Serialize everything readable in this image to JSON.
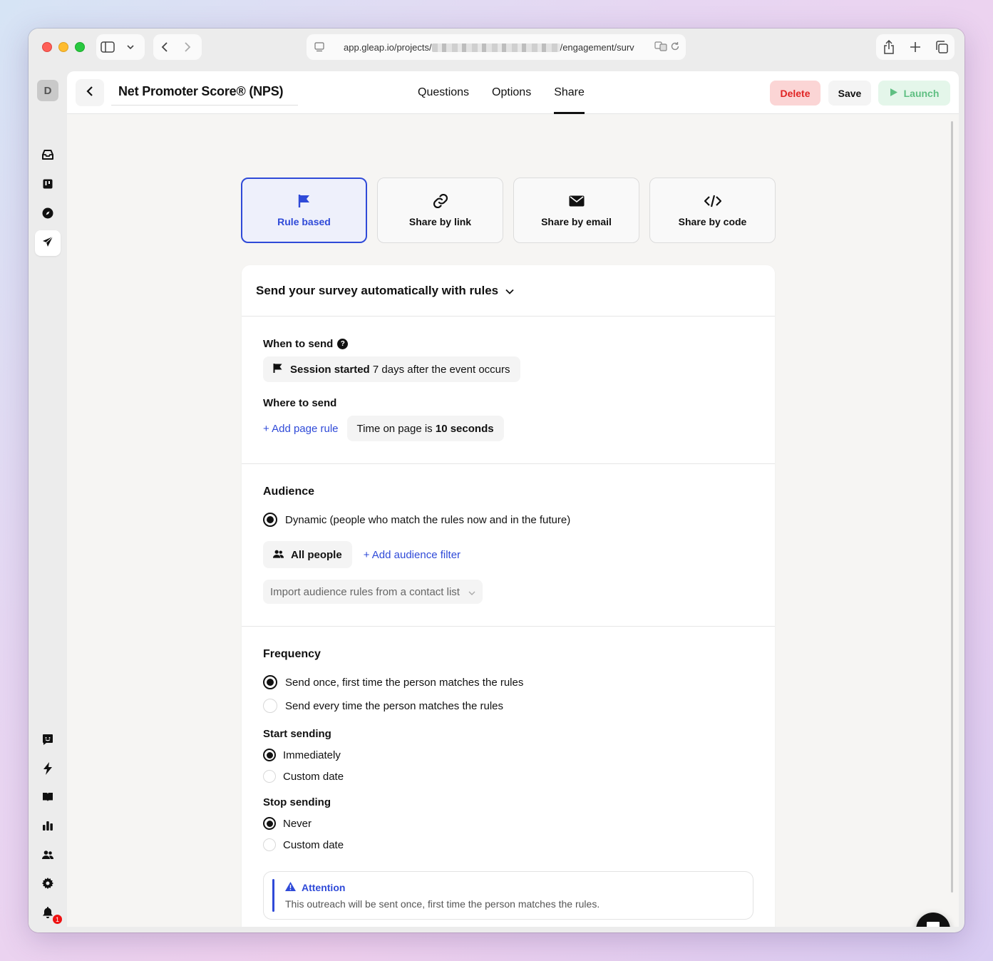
{
  "browser": {
    "url_prefix": "app.gleap.io/projects/",
    "url_suffix": "/engagement/surv"
  },
  "header": {
    "survey_title": "Net Promoter Score® (NPS)",
    "tabs": [
      {
        "label": "Questions"
      },
      {
        "label": "Options"
      },
      {
        "label": "Share"
      }
    ],
    "delete_label": "Delete",
    "save_label": "Save",
    "launch_label": "Launch"
  },
  "sidebar": {
    "workspace_initial": "D",
    "notification_count": "1"
  },
  "share_options": [
    {
      "label": "Rule based",
      "icon": "flag-icon"
    },
    {
      "label": "Share by link",
      "icon": "link-icon"
    },
    {
      "label": "Share by email",
      "icon": "envelope-icon"
    },
    {
      "label": "Share by code",
      "icon": "code-icon"
    }
  ],
  "panel": {
    "heading": "Send your survey automatically with rules",
    "when": {
      "label": "When to send",
      "event_name": "Session started",
      "event_detail": "7 days after the event occurs"
    },
    "where": {
      "label": "Where to send",
      "add_rule": "+ Add page rule",
      "rule_prefix": "Time on page is",
      "rule_value": "10 seconds"
    },
    "audience": {
      "label": "Audience",
      "option_dynamic": "Dynamic (people who match the rules now and in the future)",
      "all_people": "All people",
      "add_filter": "+ Add audience filter",
      "import_placeholder": "Import audience rules from a contact list"
    },
    "frequency": {
      "label": "Frequency",
      "option_once": "Send once, first time the person matches the rules",
      "option_every": "Send every time the person matches the rules"
    },
    "start": {
      "label": "Start sending",
      "option_immediately": "Immediately",
      "option_custom": "Custom date"
    },
    "stop": {
      "label": "Stop sending",
      "option_never": "Never",
      "option_custom": "Custom date"
    },
    "attention": {
      "title": "Attention",
      "text": "This outreach will be sent once, first time the person matches the rules."
    }
  },
  "colors": {
    "accent": "#2f4ad8",
    "delete_bg": "#fbd5d5",
    "delete_text": "#e02424",
    "launch_bg": "#e4f6ea",
    "launch_text": "#5fbf82"
  }
}
